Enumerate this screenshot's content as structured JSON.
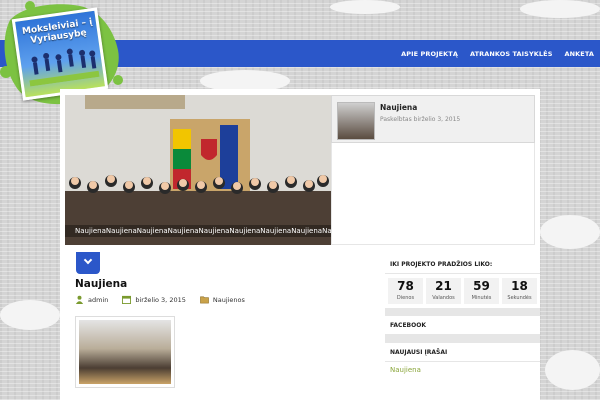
{
  "logo": {
    "text": "Moksleiviai – į Vyriausybę"
  },
  "nav": {
    "items": [
      {
        "label": "APIE PROJEKTĄ"
      },
      {
        "label": "ATRANKOS TAISYKLĖS"
      },
      {
        "label": "ANKETA"
      }
    ]
  },
  "slider": {
    "caption": "NaujienaNaujienaNaujienaNaujienaNaujienaNaujienaNaujienaNaujienaNaujienaNaujiena",
    "thumb": {
      "title": "Naujiena",
      "date": "Paskelbtas birželio 3, 2015"
    }
  },
  "post": {
    "title": "Naujiena",
    "author": "admin",
    "date": "birželio 3, 2015",
    "category": "Naujienos"
  },
  "sidebar": {
    "countdown_title": "IKI PROJEKTO PRADŽIOS LIKO:",
    "countdown": [
      {
        "value": "78",
        "label": "Dienos"
      },
      {
        "value": "21",
        "label": "Valandos"
      },
      {
        "value": "59",
        "label": "Minutės"
      },
      {
        "value": "18",
        "label": "Sekundės"
      }
    ],
    "facebook_title": "FACEBOOK",
    "recent_title": "NAUJAUSI ĮRAŠAI",
    "recent_items": [
      {
        "label": "Naujiena"
      }
    ]
  },
  "colors": {
    "nav_bg": "#2b57c9",
    "link": "#8aa53a"
  }
}
